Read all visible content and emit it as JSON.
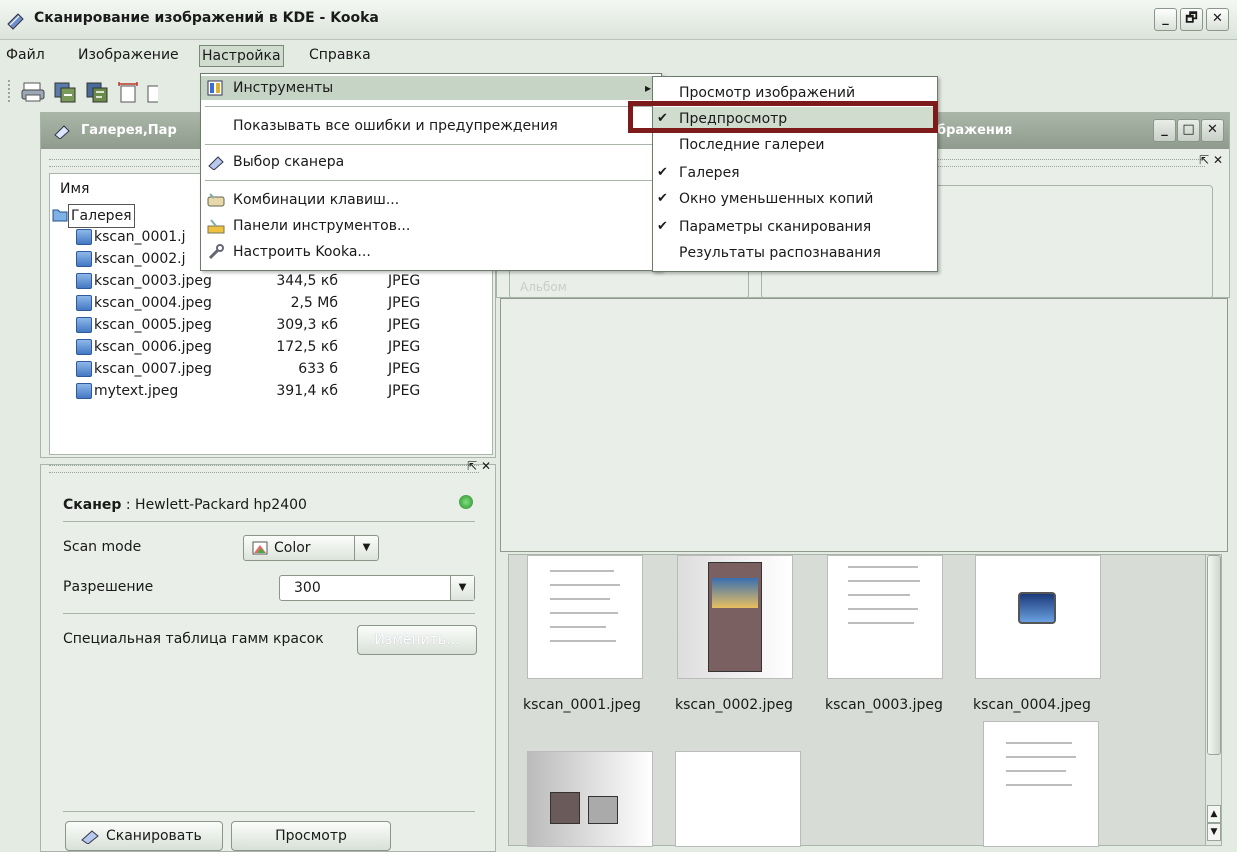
{
  "window": {
    "title": "Сканирование изображений в KDE - Kooka",
    "min": "_",
    "max": "🗗",
    "close": "✕"
  },
  "menubar": {
    "file": "Файл",
    "image": "Изображение",
    "settings": "Настройка",
    "help": "Справка"
  },
  "settings_menu": {
    "tools": "Инструменты",
    "show_errors": "Показывать все ошибки и предупреждения",
    "select_scanner": "Выбор сканера",
    "shortcuts": "Комбинации клавиш...",
    "toolbars": "Панели инструментов...",
    "configure": "Настроить Kooka...",
    "arrow": "▸"
  },
  "tools_submenu": {
    "items": [
      {
        "label": "Просмотр изображений",
        "check": ""
      },
      {
        "label": "Предпросмотр",
        "check": "✔"
      },
      {
        "label": "Последние галереи",
        "check": ""
      },
      {
        "label": "Галерея",
        "check": "✔"
      },
      {
        "label": "Окно уменьшенных копий",
        "check": "✔"
      },
      {
        "label": "Параметры сканирования",
        "check": "✔"
      },
      {
        "label": "Результаты распознавания",
        "check": ""
      }
    ]
  },
  "left_dock": {
    "title": "Галерея,Пар",
    "column_name": "Имя",
    "root": "Галерея",
    "files": [
      {
        "name": "kscan_0001.j",
        "size": "",
        "type": ""
      },
      {
        "name": "kscan_0002.j",
        "size": "",
        "type": ""
      },
      {
        "name": "kscan_0003.jpeg",
        "size": "344,5 кб",
        "type": "JPEG"
      },
      {
        "name": "kscan_0004.jpeg",
        "size": "2,5 Мб",
        "type": "JPEG"
      },
      {
        "name": "kscan_0005.jpeg",
        "size": "309,3 кб",
        "type": "JPEG"
      },
      {
        "name": "kscan_0006.jpeg",
        "size": "172,5 кб",
        "type": "JPEG"
      },
      {
        "name": "kscan_0007.jpeg",
        "size": "633 б",
        "type": "JPEG"
      },
      {
        "name": "mytext.jpeg",
        "size": "391,4 кб",
        "type": "JPEG"
      }
    ]
  },
  "scanner_panel": {
    "scanner_label": "Сканер",
    "scanner_name": " : Hewlett-Packard hp2400",
    "scan_mode_label": "Scan mode",
    "scan_mode_value": "Color",
    "resolution_label": "Разрешение",
    "resolution_value": "300",
    "gamma_label": "Специальная таблица гамм красок",
    "gamma_button": "Изменить...",
    "scan_button": "Сканировать",
    "preview_button": "Просмотр"
  },
  "right_dock": {
    "title": "бражения",
    "partial_radio": "Альбом"
  },
  "thumbnails": {
    "items": [
      "kscan_0001.jpeg",
      "kscan_0002.jpeg",
      "kscan_0003.jpeg",
      "kscan_0004.jpeg"
    ]
  },
  "dock_controls": {
    "float": "⇱",
    "close": "✕"
  },
  "colors": {
    "highlight_box": "#7d1a1a",
    "menu_hover": "#cfdcce"
  }
}
